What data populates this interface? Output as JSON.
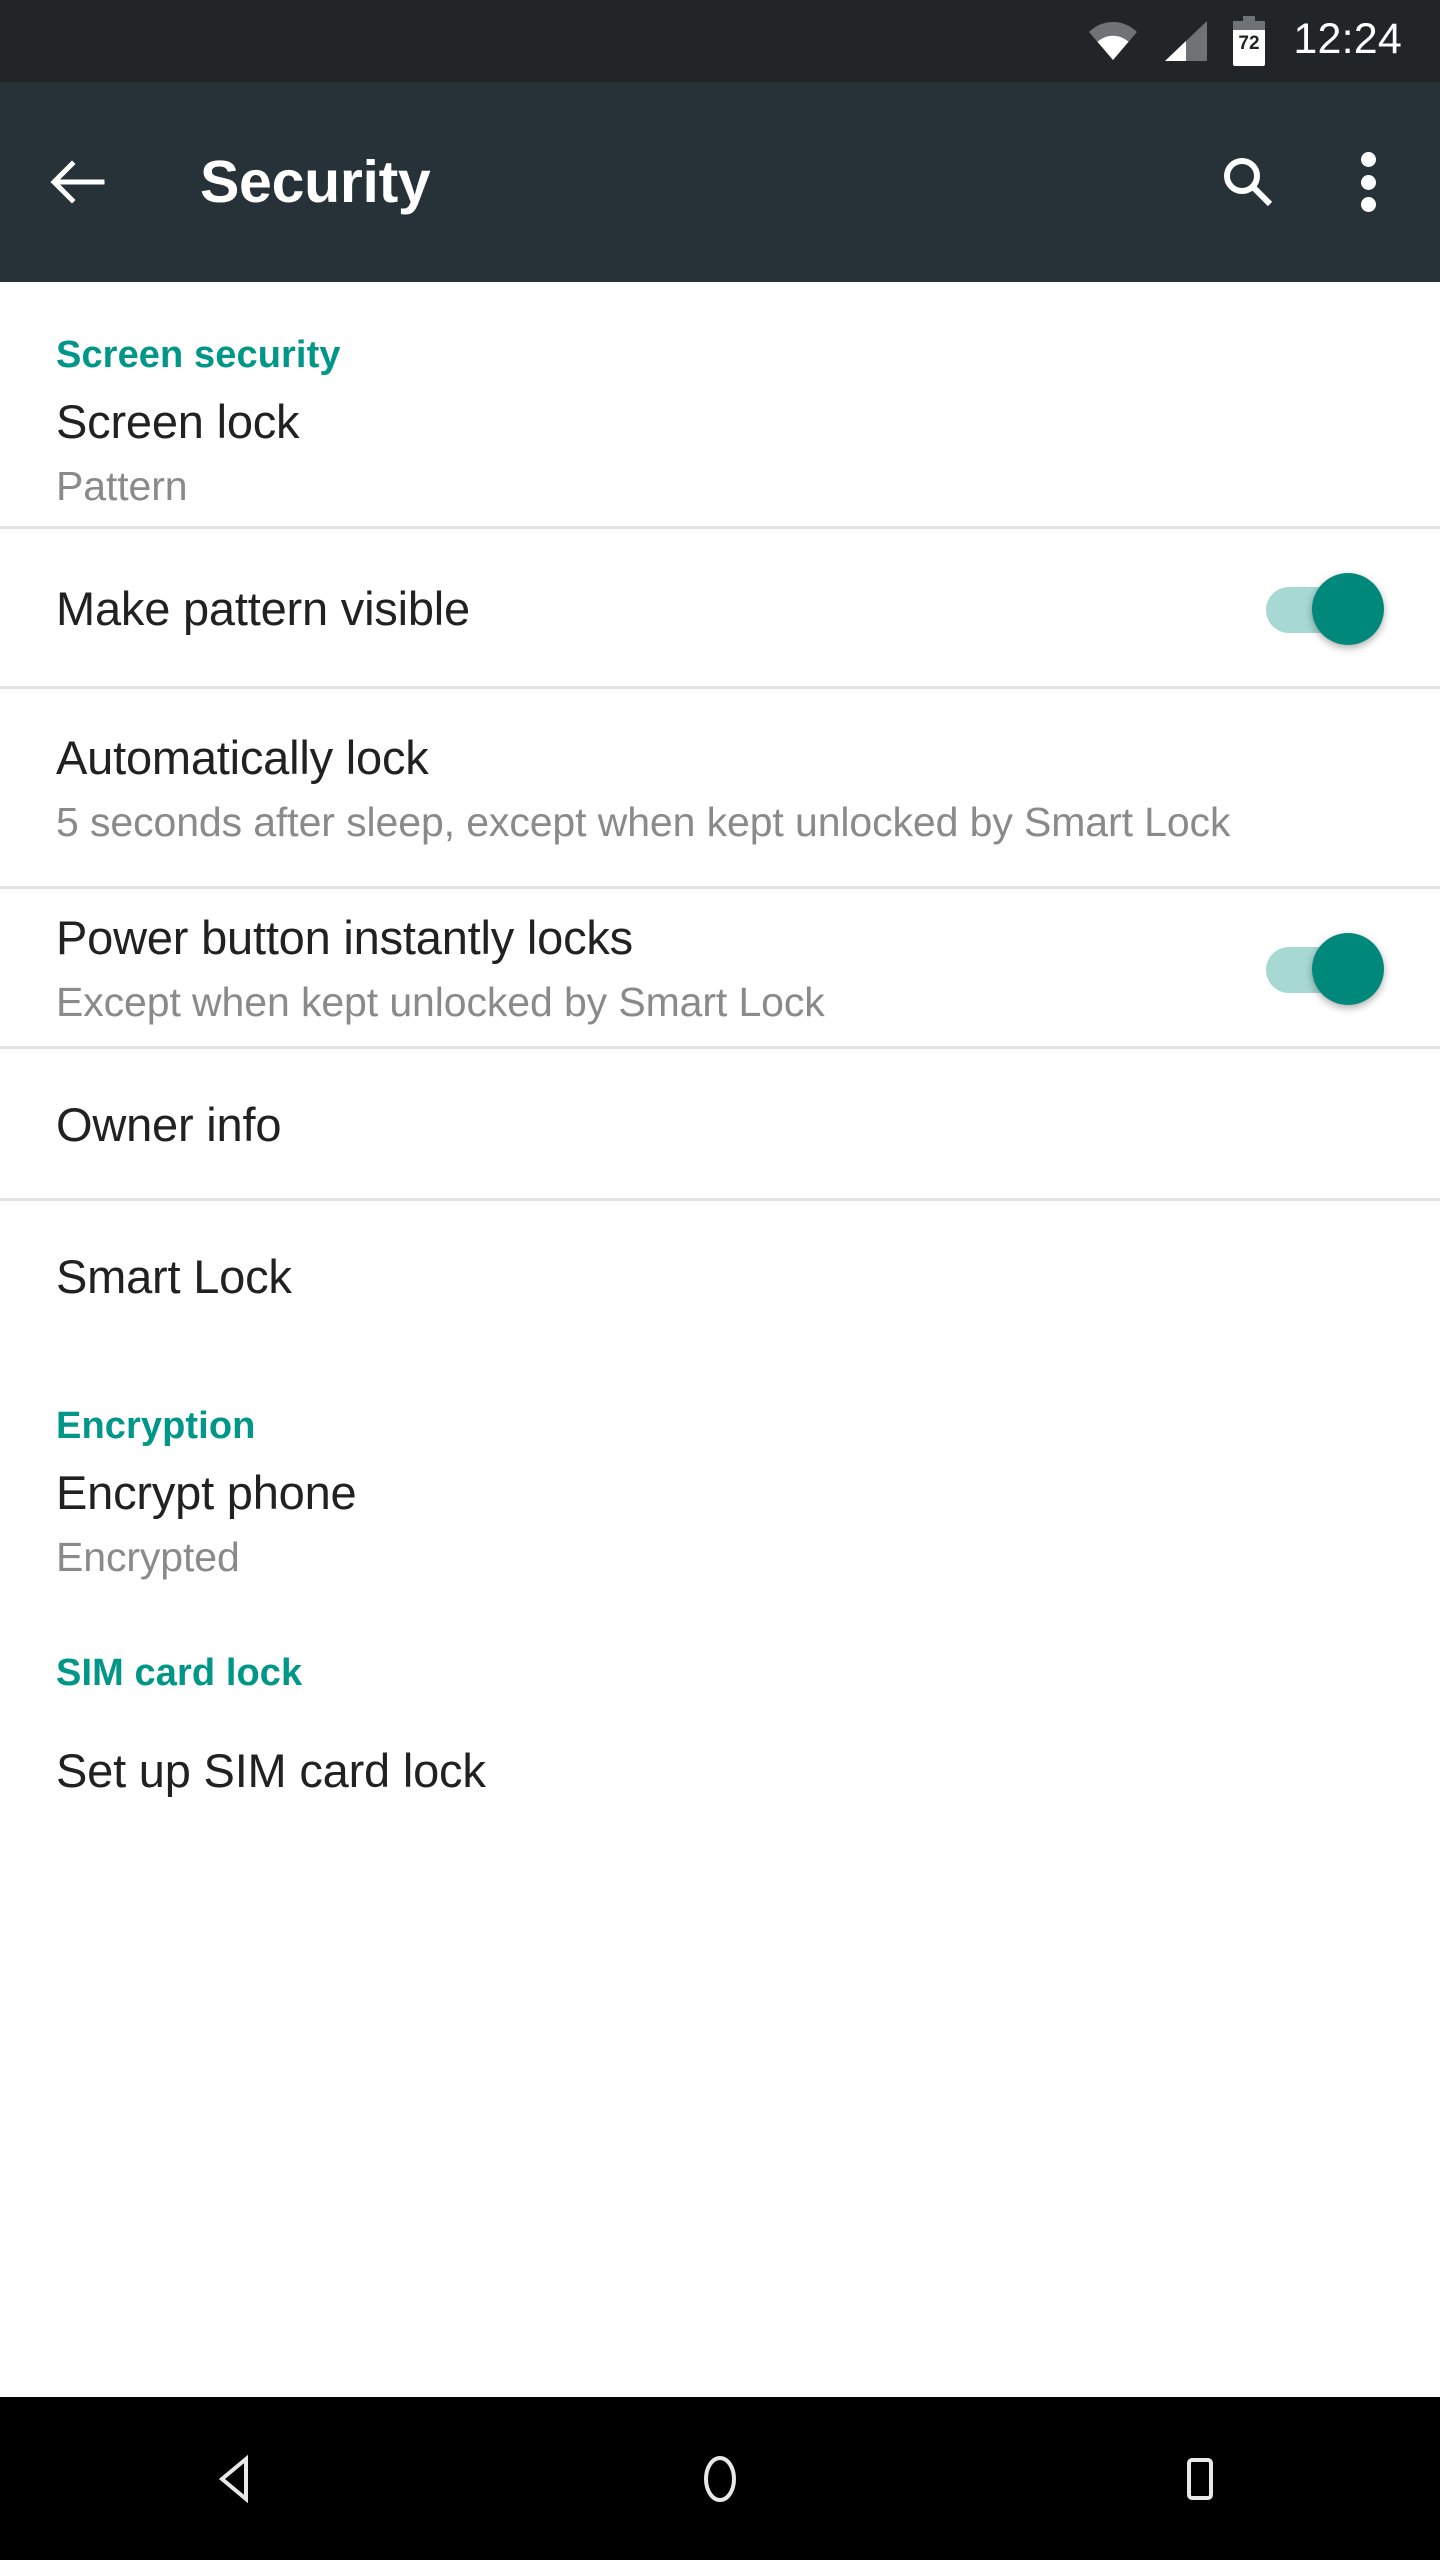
{
  "status_bar": {
    "wifi_icon": "wifi-icon",
    "signal_icon": "cellular-signal-icon",
    "battery_icon": "battery-icon",
    "battery_level": "72",
    "time": "12:24"
  },
  "app_bar": {
    "back_icon": "back-arrow-icon",
    "title": "Security",
    "search_icon": "search-icon",
    "overflow_icon": "overflow-menu-icon"
  },
  "colors": {
    "accent_teal": "#009688",
    "app_bar_bg": "#263238",
    "status_bar_bg": "#212528",
    "switch_thumb_on": "#00897b",
    "switch_track_on": "#a7d8d3",
    "primary_text": "#212121",
    "secondary_text": "#8a8a8a",
    "divider": "#e2e2e2",
    "nav_bar_bg": "#000000"
  },
  "sections": [
    {
      "header": "Screen security",
      "items": [
        {
          "title": "Screen lock",
          "subtitle": "Pattern",
          "control": "none"
        },
        {
          "title": "Make pattern visible",
          "subtitle": "",
          "control": "switch",
          "switch_state": "on"
        },
        {
          "title": "Automatically lock",
          "subtitle": "5 seconds after sleep, except when kept unlocked by Smart Lock",
          "control": "none"
        },
        {
          "title": "Power button instantly locks",
          "subtitle": "Except when kept unlocked by Smart Lock",
          "control": "switch",
          "switch_state": "on"
        },
        {
          "title": "Owner info",
          "subtitle": "",
          "control": "none"
        },
        {
          "title": "Smart Lock",
          "subtitle": "",
          "control": "none"
        }
      ]
    },
    {
      "header": "Encryption",
      "items": [
        {
          "title": "Encrypt phone",
          "subtitle": "Encrypted",
          "control": "none"
        }
      ]
    },
    {
      "header": "SIM card lock",
      "items": [
        {
          "title": "Set up SIM card lock",
          "subtitle": "",
          "control": "none"
        }
      ]
    }
  ],
  "nav_bar": {
    "back_icon": "nav-back-triangle-icon",
    "home_icon": "nav-home-circle-icon",
    "recents_icon": "nav-recents-square-icon"
  }
}
